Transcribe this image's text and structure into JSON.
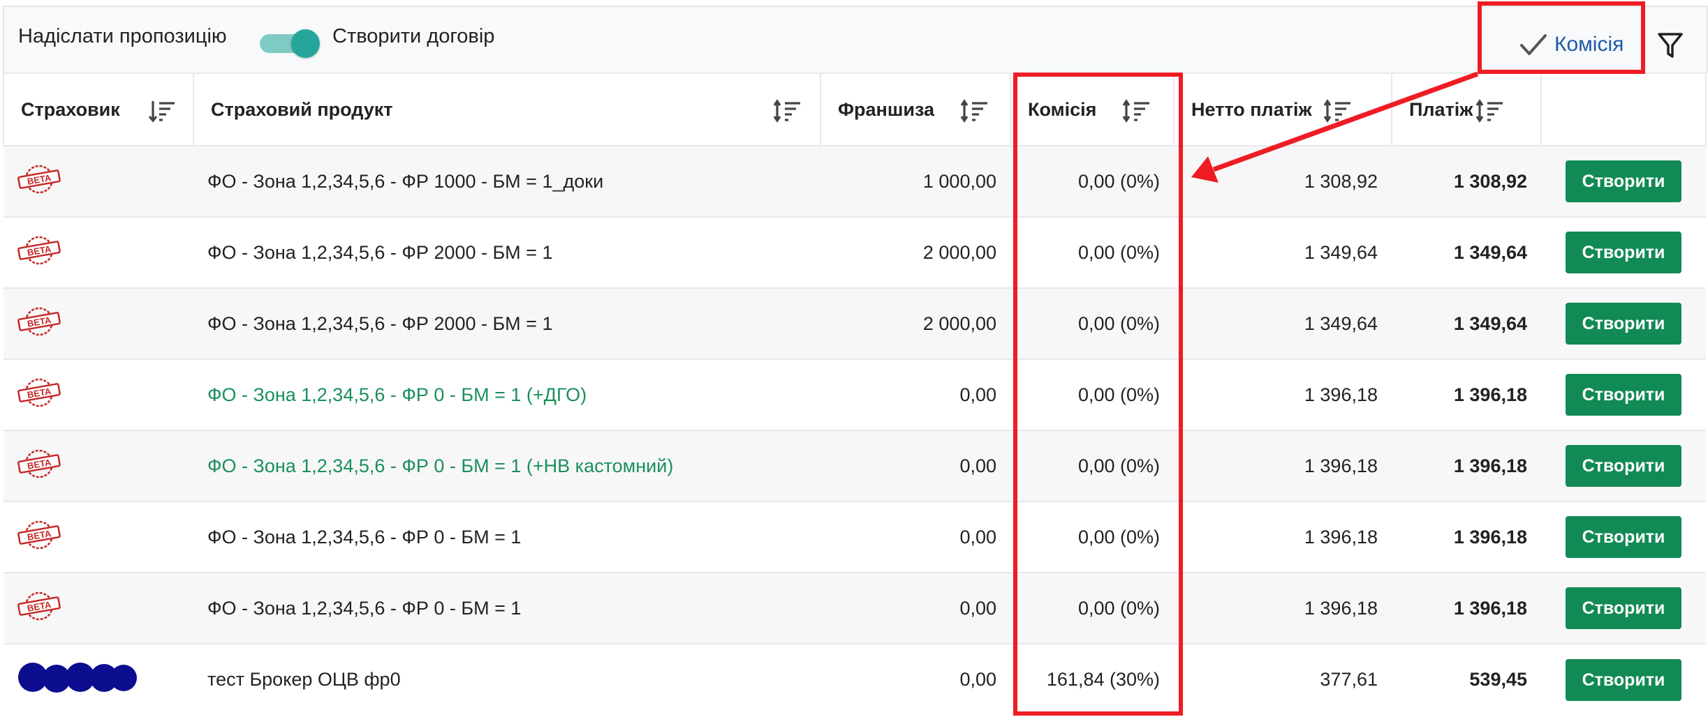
{
  "toolbar": {
    "send_offer_label": "Надіслати пропозицію",
    "create_contract_label": "Створити договір",
    "commission_label": "Комісія"
  },
  "columns": [
    "Страховик",
    "Страховий продукт",
    "Франшиза",
    "Комісія",
    "Нетто платіж",
    "Платіж"
  ],
  "rows": [
    {
      "product": "ФО - Зона 1,2,34,5,6 - ФР 1000 - БМ = 1_доки",
      "franchise": "1 000,00",
      "commission": "0,00 (0%)",
      "net": "1 308,92",
      "payment": "1 308,92",
      "action": "Створити"
    },
    {
      "product": "ФО - Зона 1,2,34,5,6 - ФР 2000 - БМ = 1",
      "franchise": "2 000,00",
      "commission": "0,00 (0%)",
      "net": "1 349,64",
      "payment": "1 349,64",
      "action": "Створити"
    },
    {
      "product": "ФО - Зона 1,2,34,5,6 - ФР 2000 - БМ = 1",
      "franchise": "2 000,00",
      "commission": "0,00 (0%)",
      "net": "1 349,64",
      "payment": "1 349,64",
      "action": "Створити"
    },
    {
      "product": "ФО - Зона 1,2,34,5,6 - ФР 0 - БМ = 1 (+ДГО)",
      "franchise": "0,00",
      "commission": "0,00 (0%)",
      "net": "1 396,18",
      "payment": "1 396,18",
      "action": "Створити"
    },
    {
      "product": "ФО - Зона 1,2,34,5,6 - ФР 0 - БМ = 1 (+НВ кастомний)",
      "franchise": "0,00",
      "commission": "0,00 (0%)",
      "net": "1 396,18",
      "payment": "1 396,18",
      "action": "Створити"
    },
    {
      "product": "ФО - Зона 1,2,34,5,6 - ФР 0 - БМ = 1",
      "franchise": "0,00",
      "commission": "0,00 (0%)",
      "net": "1 396,18",
      "payment": "1 396,18",
      "action": "Створити"
    },
    {
      "product": "ФО - Зона 1,2,34,5,6 - ФР 0 - БМ = 1",
      "franchise": "0,00",
      "commission": "0,00 (0%)",
      "net": "1 396,18",
      "payment": "1 396,18",
      "action": "Створити"
    },
    {
      "product": "тест Брокер ОЦВ фр0",
      "franchise": "0,00",
      "commission": "161,84 (30%)",
      "net": "377,61",
      "payment": "539,45",
      "action": "Створити"
    }
  ],
  "logo_text": "BETA",
  "colors": {
    "accent_green": "#128a55",
    "highlight_text_green": "#1a8f5c",
    "toggle_teal": "#26a69a",
    "link_blue": "#1e5aa8",
    "annotation_red": "#ee1c24"
  },
  "icons": [
    "check-icon",
    "filter-icon",
    "sort-icon",
    "beta-stamp-logo",
    "redacted-logo"
  ]
}
